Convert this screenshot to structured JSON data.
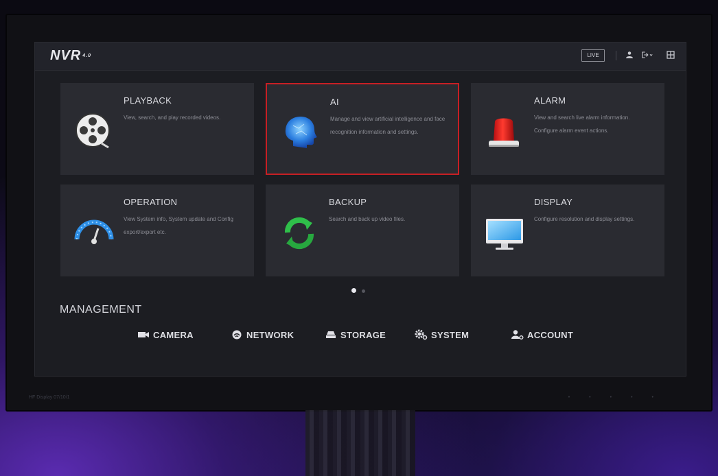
{
  "app": {
    "logo_text": "NVR",
    "logo_version": "4.0",
    "live_label": "LIVE",
    "footer_text": "HF Display 07/10/1"
  },
  "tiles": [
    {
      "title": "PLAYBACK",
      "desc": "View, search, and play recorded videos.",
      "icon": "film-reel-icon"
    },
    {
      "title": "AI",
      "desc": "Manage and view artificial intelligence and face recognition information and settings.",
      "icon": "ai-head-icon",
      "selected": true
    },
    {
      "title": "ALARM",
      "desc": "View and search live alarm information. Configure alarm event actions.",
      "icon": "alarm-siren-icon"
    },
    {
      "title": "OPERATION",
      "desc": "View System info, System update and Config export/export etc.",
      "icon": "gauge-icon"
    },
    {
      "title": "BACKUP",
      "desc": "Search and back up video files.",
      "icon": "sync-icon"
    },
    {
      "title": "DISPLAY",
      "desc": "Configure resolution and display settings.",
      "icon": "monitor-icon"
    }
  ],
  "pager": {
    "current": 1,
    "total": 2
  },
  "management": {
    "title": "MANAGEMENT",
    "items": [
      {
        "label": "CAMERA",
        "icon": "camera-icon"
      },
      {
        "label": "NETWORK",
        "icon": "network-icon"
      },
      {
        "label": "STORAGE",
        "icon": "storage-icon"
      },
      {
        "label": "SYSTEM",
        "icon": "system-gear-icon"
      },
      {
        "label": "ACCOUNT",
        "icon": "account-icon"
      }
    ]
  },
  "colors": {
    "selection_border": "#c81f24",
    "tile_bg": "#2a2b31",
    "screen_bg": "#1c1d22"
  }
}
